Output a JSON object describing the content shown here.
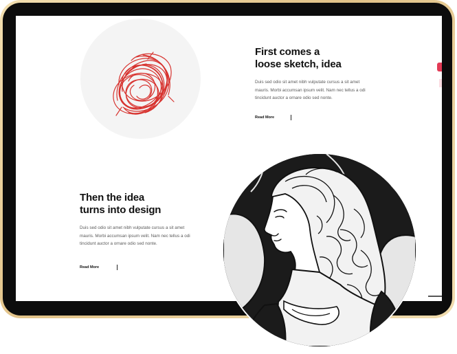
{
  "section1": {
    "title_line1": "First comes a",
    "title_line2": "loose sketch, idea",
    "body_line1": "Duis sed odio sit amet nibh vulputate cursus a sit amet",
    "body_line2": "mauris. Morbi accumsan ipsum velit. Nam nec tellus a odi",
    "body_line3": "tincidunt auctor a ornare odio sed nonte.",
    "read_more": "Read More"
  },
  "section2": {
    "title_line1": "Then the idea",
    "title_line2": "turns into design",
    "body_line1": "Duis sed odio sit amet nibh vulputate cursus a sit amet",
    "body_line2": "mauris. Morbi accumsan ipsum velit. Nam nec tellus a odi",
    "body_line3": "tincidunt auctor a ornare odio sed nonte.",
    "read_more": "Read More"
  },
  "colors": {
    "accent": "#e23a55",
    "sketch": "#d7332f",
    "frame_gold": "#e2c389"
  },
  "icons": {
    "sketch": "red-scribble-illustration",
    "artwork": "woman-portrait-illustration"
  }
}
